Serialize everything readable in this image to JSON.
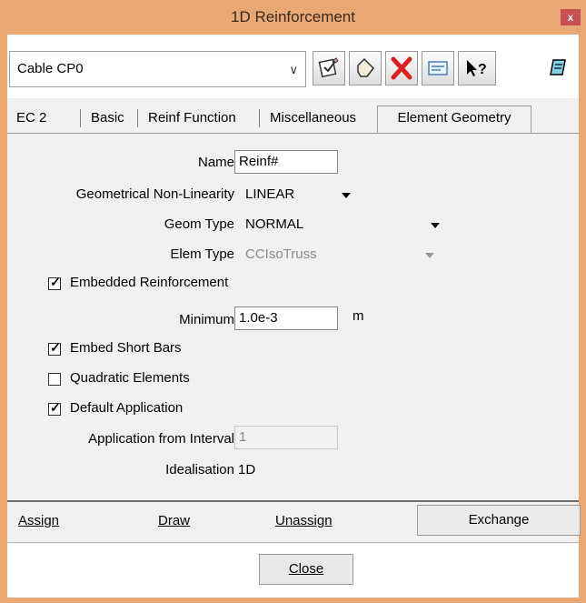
{
  "window": {
    "title": "1D Reinforcement",
    "close_label": "x"
  },
  "toolbar": {
    "selector_value": "Cable CP0",
    "buttons": [
      "edit-icon",
      "eraser-icon",
      "delete-icon",
      "list-icon",
      "help-icon",
      "notes-icon"
    ]
  },
  "tabs": [
    {
      "label": "EC 2"
    },
    {
      "label": "Basic"
    },
    {
      "label": "Reinf Function"
    },
    {
      "label": "Miscellaneous"
    },
    {
      "label": "Element Geometry",
      "active": true
    }
  ],
  "form": {
    "name_label": "Name",
    "name_value": "Reinf#",
    "geo_nonlin_label": "Geometrical Non-Linearity",
    "geo_nonlin_value": "LINEAR",
    "geom_type_label": "Geom Type",
    "geom_type_value": "NORMAL",
    "elem_type_label": "Elem Type",
    "elem_type_value": "CCIsoTruss",
    "embedded_label": "Embedded Reinforcement",
    "embedded_checked": true,
    "minimum_label": "Minimum",
    "minimum_value": "1.0e-3",
    "minimum_unit": "m",
    "embed_short_label": "Embed Short Bars",
    "embed_short_checked": true,
    "quadratic_label": "Quadratic Elements",
    "quadratic_checked": false,
    "default_app_label": "Default Application",
    "default_app_checked": true,
    "app_interval_label": "Application from Interval",
    "app_interval_value": "1",
    "idealisation_label": "Idealisation",
    "idealisation_value": "1D"
  },
  "actions": {
    "assign": "Assign",
    "draw": "Draw",
    "unassign": "Unassign",
    "exchange": "Exchange"
  },
  "footer": {
    "close": "Close"
  },
  "colors": {
    "titlebar": "#e9a873",
    "close": "#c75050",
    "delete": "#e02020"
  }
}
